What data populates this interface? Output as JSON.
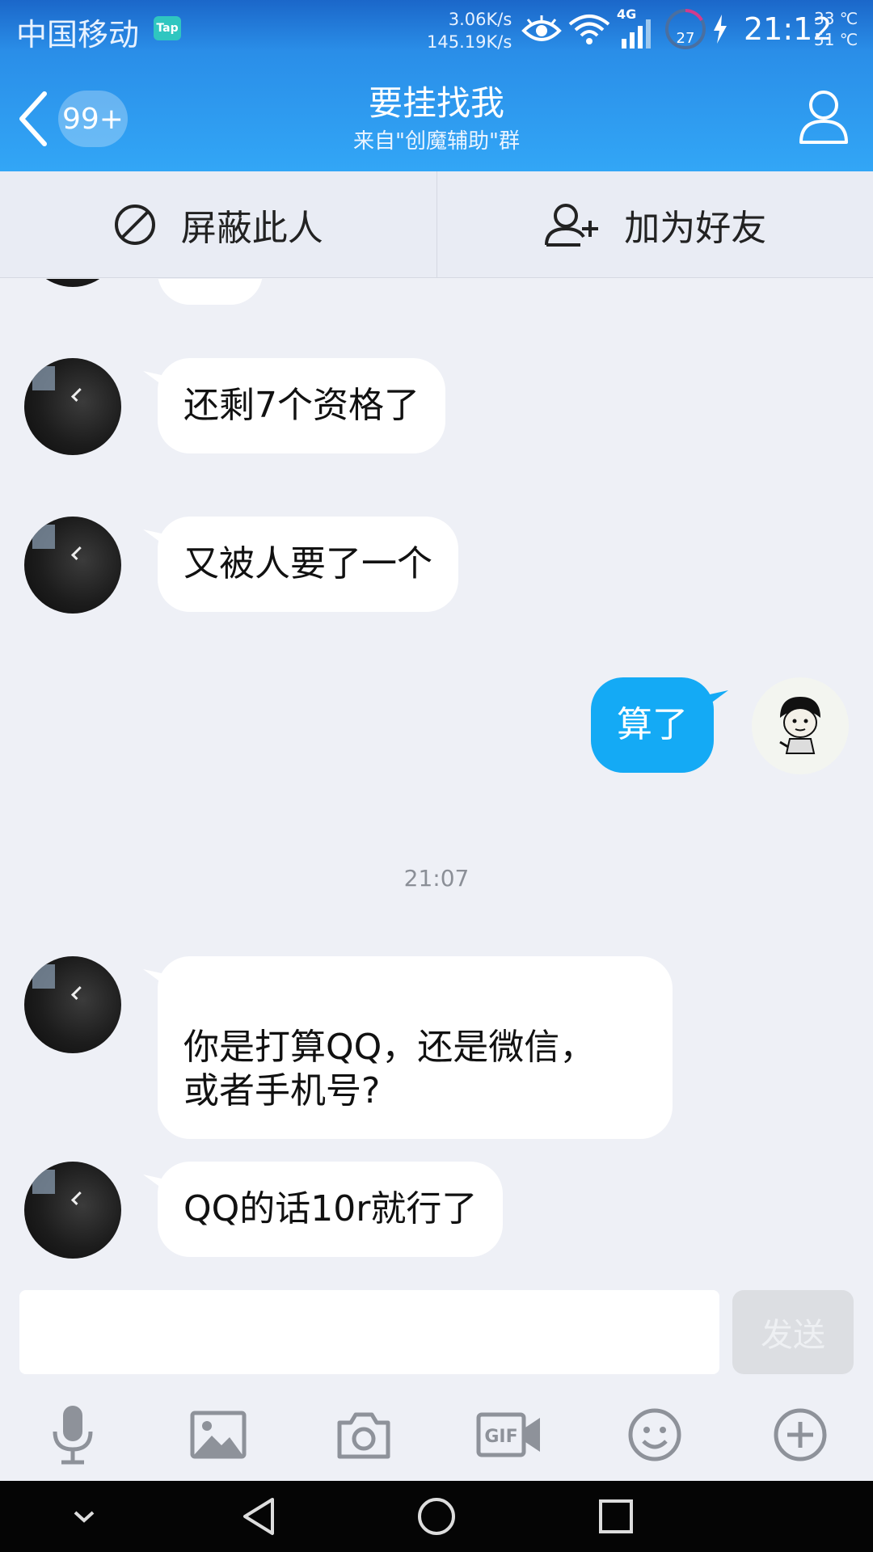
{
  "status_bar": {
    "carrier": "中国移动",
    "tap_badge": "Tap",
    "upload_speed": "3.06K/s",
    "download_speed": "145.19K/s",
    "network_type": "4G",
    "battery_level": "27",
    "time": "21:12",
    "temp_1": "33 ℃",
    "temp_2": "51 ℃"
  },
  "header": {
    "unread_count": "99+",
    "title": "要挂找我",
    "subtitle": "来自\"创魔辅助\"群"
  },
  "actions": {
    "block_label": "屏蔽此人",
    "add_friend_label": "加为好友"
  },
  "messages": [
    {
      "direction": "in",
      "text": "还剩7个资格了"
    },
    {
      "direction": "in",
      "text": "又被人要了一个"
    },
    {
      "direction": "out",
      "text": "算了"
    },
    {
      "direction": "in",
      "text": "你是打算QQ，还是微信，\n或者手机号?"
    },
    {
      "direction": "in",
      "text": "QQ的话10r就行了"
    }
  ],
  "timestamp": "21:07",
  "input": {
    "value": "",
    "send_label": "发送"
  },
  "toolbar": {
    "icons": [
      "microphone-icon",
      "image-icon",
      "camera-icon",
      "gif-icon",
      "emoji-icon",
      "plus-icon"
    ]
  },
  "colors": {
    "header_gradient_top": "#1b67c9",
    "header_gradient_bottom": "#32a6f6",
    "outgoing_bubble": "#14aaf5",
    "chat_background": "#eef0f6"
  }
}
